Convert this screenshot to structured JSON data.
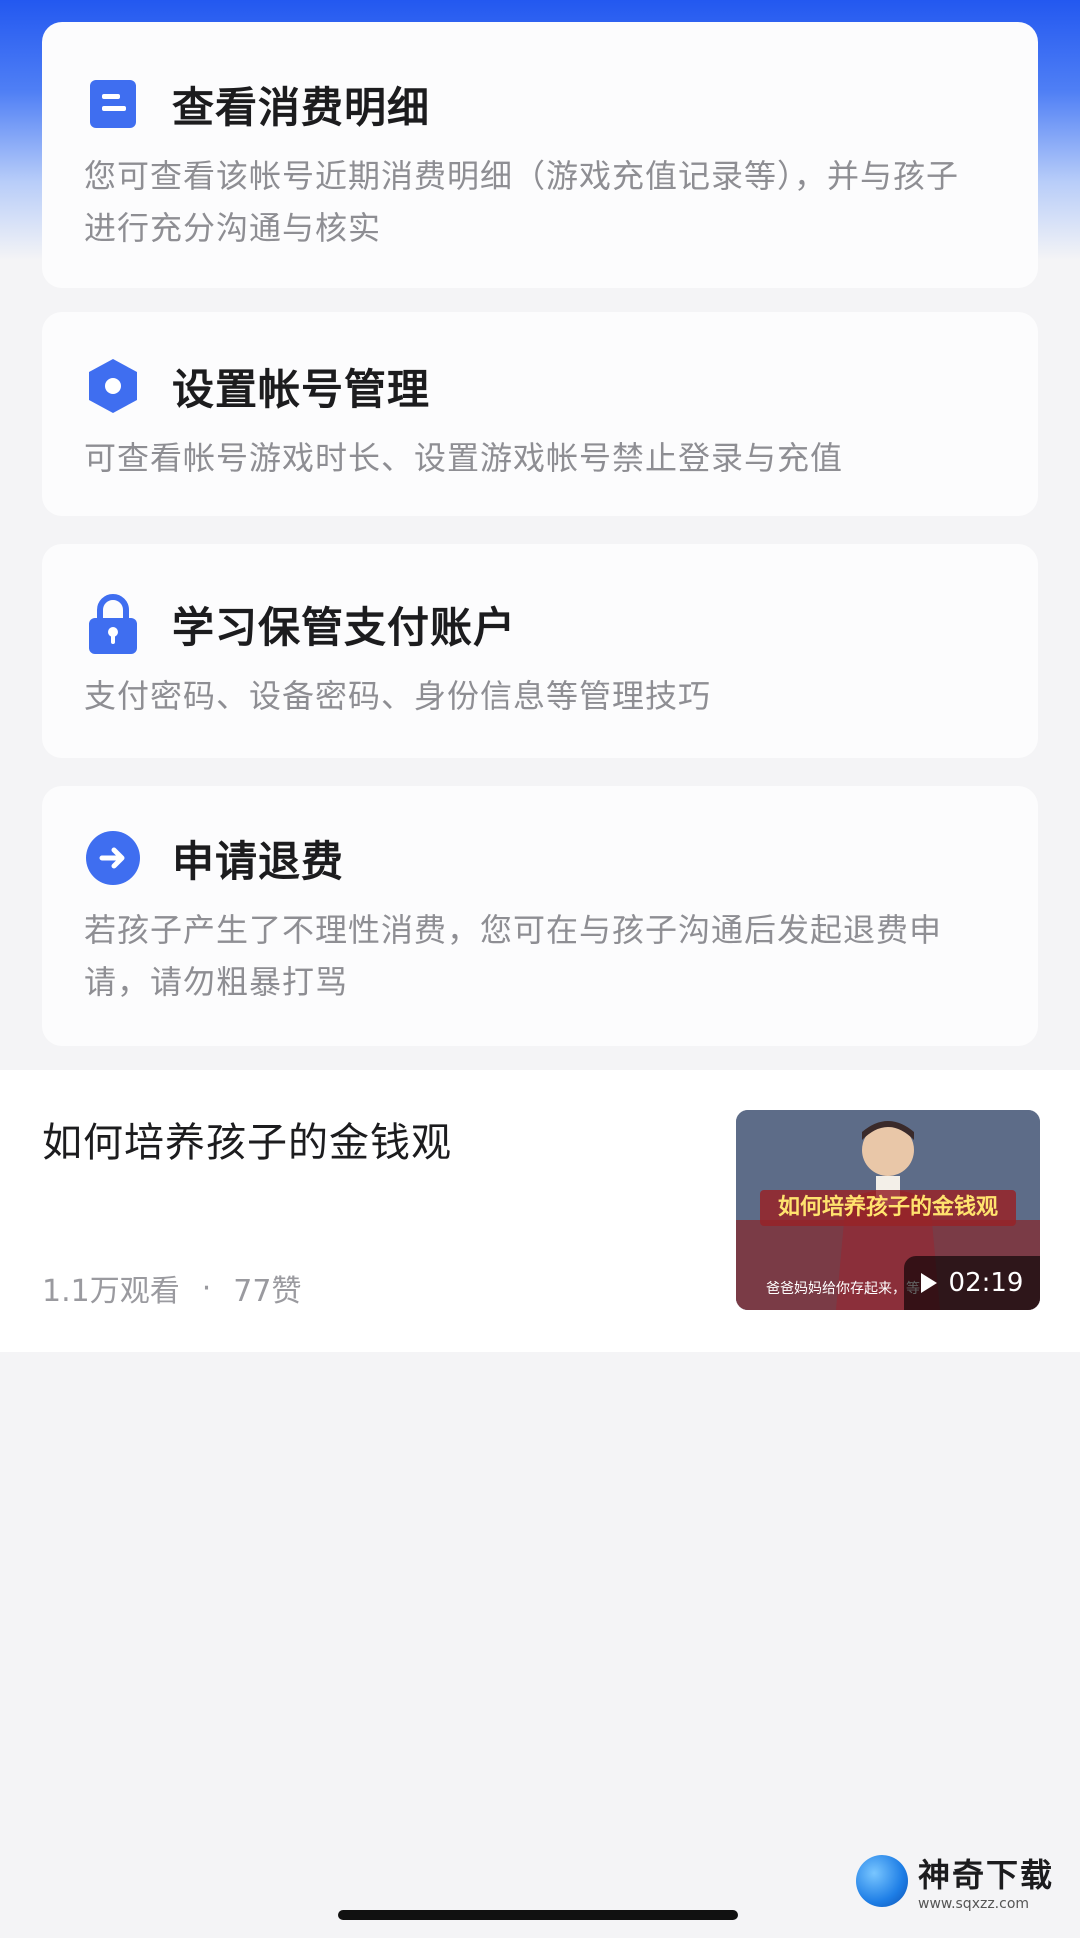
{
  "cards": [
    {
      "icon": "document-icon",
      "title": "查看消费明细",
      "desc": "您可查看该帐号近期消费明细（游戏充值记录等），并与孩子进行充分沟通与核实"
    },
    {
      "icon": "hexagon-settings-icon",
      "title": "设置帐号管理",
      "desc": "可查看帐号游戏时长、设置游戏帐号禁止登录与充值"
    },
    {
      "icon": "lock-icon",
      "title": "学习保管支付账户",
      "desc": "支付密码、设备密码、身份信息等管理技巧"
    },
    {
      "icon": "arrow-right-circle-icon",
      "title": "申请退费",
      "desc": "若孩子产生了不理性消费，您可在与孩子沟通后发起退费申请，请勿粗暴打骂"
    }
  ],
  "article": {
    "title": "如何培养孩子的金钱观",
    "views": "1.1万观看",
    "dot": "·",
    "likes": "77赞",
    "thumb_caption": "如何培养孩子的金钱观",
    "thumb_subtitle": "爸爸妈妈给你存起来，等",
    "duration": "02:19"
  },
  "watermark": {
    "name": "神奇下载",
    "url": "www.sqxzz.com"
  },
  "colors": {
    "accent": "#3f6ef0",
    "header_blue": "#2358f0"
  }
}
